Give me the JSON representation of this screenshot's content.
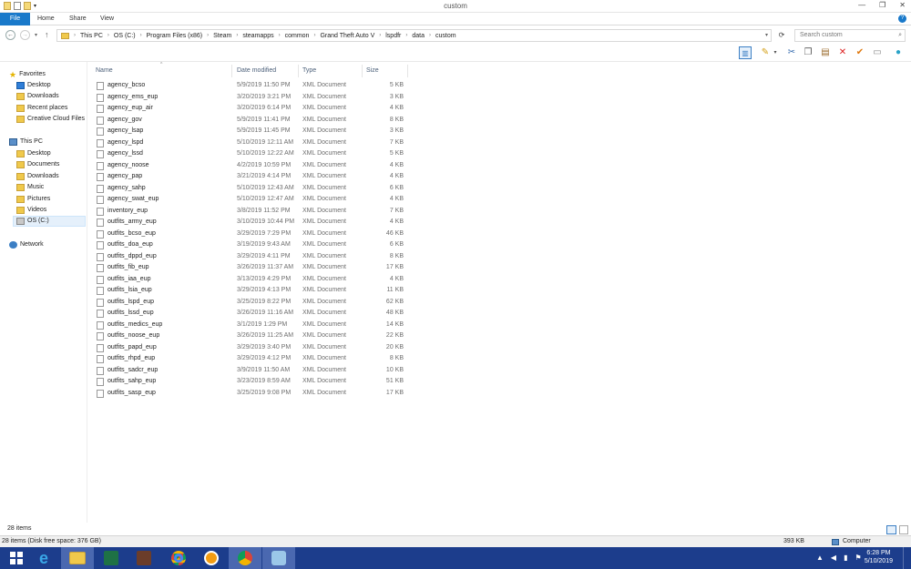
{
  "window": {
    "title": "custom"
  },
  "ribbon": {
    "tabs": [
      "File",
      "Home",
      "Share",
      "View"
    ]
  },
  "address": {
    "crumbs": [
      "This PC",
      "OS (C:)",
      "Program Files (x86)",
      "Steam",
      "steamapps",
      "common",
      "Grand Theft Auto V",
      "lspdfr",
      "data",
      "custom"
    ]
  },
  "search": {
    "placeholder": "Search custom"
  },
  "nav": {
    "favorites": {
      "label": "Favorites",
      "items": [
        "Desktop",
        "Downloads",
        "Recent places",
        "Creative Cloud Files"
      ]
    },
    "thispc": {
      "label": "This PC",
      "items": [
        "Desktop",
        "Documents",
        "Downloads",
        "Music",
        "Pictures",
        "Videos",
        "OS (C:)"
      ]
    },
    "network": {
      "label": "Network"
    }
  },
  "columns": {
    "name": "Name",
    "date": "Date modified",
    "type": "Type",
    "size": "Size"
  },
  "files": [
    {
      "name": "agency_bcso",
      "date": "5/9/2019 11:50 PM",
      "type": "XML Document",
      "size": "5 KB"
    },
    {
      "name": "agency_ems_eup",
      "date": "3/20/2019 3:21 PM",
      "type": "XML Document",
      "size": "3 KB"
    },
    {
      "name": "agency_eup_air",
      "date": "3/20/2019 6:14 PM",
      "type": "XML Document",
      "size": "4 KB"
    },
    {
      "name": "agency_gov",
      "date": "5/9/2019 11:41 PM",
      "type": "XML Document",
      "size": "8 KB"
    },
    {
      "name": "agency_lsap",
      "date": "5/9/2019 11:45 PM",
      "type": "XML Document",
      "size": "3 KB"
    },
    {
      "name": "agency_lspd",
      "date": "5/10/2019 12:11 AM",
      "type": "XML Document",
      "size": "7 KB"
    },
    {
      "name": "agency_lssd",
      "date": "5/10/2019 12:22 AM",
      "type": "XML Document",
      "size": "5 KB"
    },
    {
      "name": "agency_noose",
      "date": "4/2/2019 10:59 PM",
      "type": "XML Document",
      "size": "4 KB"
    },
    {
      "name": "agency_pap",
      "date": "3/21/2019 4:14 PM",
      "type": "XML Document",
      "size": "4 KB"
    },
    {
      "name": "agency_sahp",
      "date": "5/10/2019 12:43 AM",
      "type": "XML Document",
      "size": "6 KB"
    },
    {
      "name": "agency_swat_eup",
      "date": "5/10/2019 12:47 AM",
      "type": "XML Document",
      "size": "4 KB"
    },
    {
      "name": "inventory_eup",
      "date": "3/8/2019 11:52 PM",
      "type": "XML Document",
      "size": "7 KB"
    },
    {
      "name": "outfits_army_eup",
      "date": "3/10/2019 10:44 PM",
      "type": "XML Document",
      "size": "4 KB"
    },
    {
      "name": "outfits_bcso_eup",
      "date": "3/29/2019 7:29 PM",
      "type": "XML Document",
      "size": "46 KB"
    },
    {
      "name": "outfits_doa_eup",
      "date": "3/19/2019 9:43 AM",
      "type": "XML Document",
      "size": "6 KB"
    },
    {
      "name": "outfits_dppd_eup",
      "date": "3/29/2019 4:11 PM",
      "type": "XML Document",
      "size": "8 KB"
    },
    {
      "name": "outfits_fib_eup",
      "date": "3/26/2019 11:37 AM",
      "type": "XML Document",
      "size": "17 KB"
    },
    {
      "name": "outfits_iaa_eup",
      "date": "3/13/2019 4:29 PM",
      "type": "XML Document",
      "size": "4 KB"
    },
    {
      "name": "outfits_lsia_eup",
      "date": "3/29/2019 4:13 PM",
      "type": "XML Document",
      "size": "11 KB"
    },
    {
      "name": "outfits_lspd_eup",
      "date": "3/25/2019 8:22 PM",
      "type": "XML Document",
      "size": "62 KB"
    },
    {
      "name": "outfits_lssd_eup",
      "date": "3/26/2019 11:16 AM",
      "type": "XML Document",
      "size": "48 KB"
    },
    {
      "name": "outfits_medics_eup",
      "date": "3/1/2019 1:29 PM",
      "type": "XML Document",
      "size": "14 KB"
    },
    {
      "name": "outfits_noose_eup",
      "date": "3/26/2019 11:25 AM",
      "type": "XML Document",
      "size": "22 KB"
    },
    {
      "name": "outfits_papd_eup",
      "date": "3/29/2019 3:40 PM",
      "type": "XML Document",
      "size": "20 KB"
    },
    {
      "name": "outfits_rhpd_eup",
      "date": "3/29/2019 4:12 PM",
      "type": "XML Document",
      "size": "8 KB"
    },
    {
      "name": "outfits_sadcr_eup",
      "date": "3/9/2019 11:50 AM",
      "type": "XML Document",
      "size": "10 KB"
    },
    {
      "name": "outfits_sahp_eup",
      "date": "3/23/2019 8:59 AM",
      "type": "XML Document",
      "size": "51 KB"
    },
    {
      "name": "outfits_sasp_eup",
      "date": "3/25/2019 9:08 PM",
      "type": "XML Document",
      "size": "17 KB"
    }
  ],
  "status": {
    "count": "28 items"
  },
  "details": {
    "left": "28 items (Disk free space: 376 GB)",
    "size": "393 KB",
    "location": "Computer"
  },
  "taskbar": {
    "time": "6:28 PM",
    "date": "5/10/2019"
  }
}
